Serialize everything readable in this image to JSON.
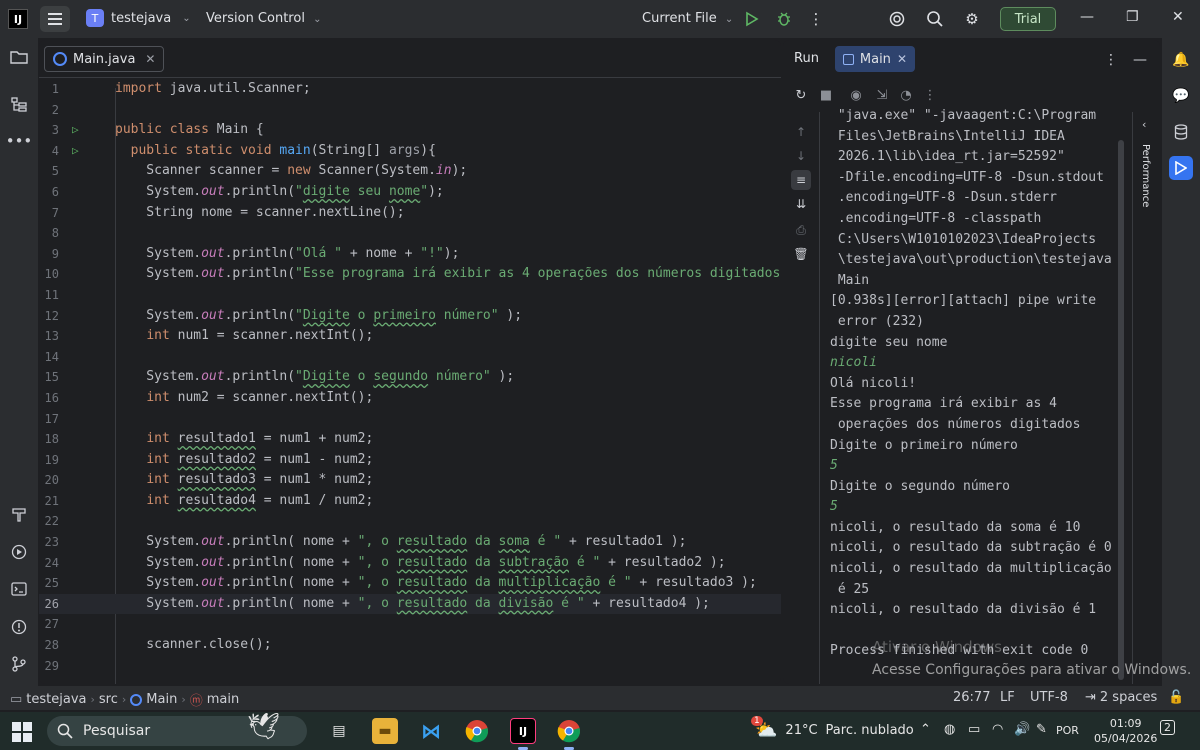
{
  "titlebar": {
    "app_logo": "IJ",
    "project_badge": "T",
    "project_name": "testejava",
    "vcs_label": "Version Control",
    "run_config": "Current File",
    "trial_label": "Trial",
    "icons": [
      "hamburger-menu-icon",
      "run-icon",
      "debug-icon",
      "more-icon",
      "ai-assistant-icon",
      "search-icon",
      "settings-gear-icon"
    ]
  },
  "editor": {
    "tab_label": "Main.java",
    "current_line": 26,
    "lines": [
      {
        "n": "1",
        "html": "<span class='kw'>import</span> java.util.Scanner;"
      },
      {
        "n": "2",
        "html": ""
      },
      {
        "n": "3",
        "html": "<span class='kw'>public class</span> Main {",
        "run": true
      },
      {
        "n": "4",
        "html": "  <span class='kw'>public static void</span> <span class='fn'>main</span>(String[] <span class='par'>args</span>){",
        "run": true
      },
      {
        "n": "5",
        "html": "    Scanner scanner = <span class='kw'>new</span> Scanner(System.<span class='fld'>in</span>);"
      },
      {
        "n": "6",
        "html": "    System.<span class='fld'>out</span>.println(<span class='str'>\"<span class='wavy'>digite</span> seu <span class='wavy'>nome</span>\"</span>);"
      },
      {
        "n": "7",
        "html": "    String nome = scanner.nextLine();"
      },
      {
        "n": "8",
        "html": ""
      },
      {
        "n": "9",
        "html": "    System.<span class='fld'>out</span>.println(<span class='str'>\"Olá \"</span> + nome + <span class='str'>\"!\"</span>);"
      },
      {
        "n": "10",
        "html": "    System.<span class='fld'>out</span>.println(<span class='str'>\"Esse programa irá exibir as 4 operações dos números digitados\"</span>);"
      },
      {
        "n": "11",
        "html": ""
      },
      {
        "n": "12",
        "html": "    System.<span class='fld'>out</span>.println(<span class='str'>\"<span class='wavy'>Digite</span> o <span class='wavy'>primeiro</span> número\"</span> );"
      },
      {
        "n": "13",
        "html": "    <span class='kw'>int</span> num1 = scanner.nextInt();"
      },
      {
        "n": "14",
        "html": ""
      },
      {
        "n": "15",
        "html": "    System.<span class='fld'>out</span>.println(<span class='str'>\"<span class='wavy'>Digite</span> o <span class='wavy'>segundo</span> número\"</span> );"
      },
      {
        "n": "16",
        "html": "    <span class='kw'>int</span> num2 = scanner.nextInt();"
      },
      {
        "n": "17",
        "html": ""
      },
      {
        "n": "18",
        "html": "    <span class='kw'>int</span> <span class='wavy2'>resultado1</span> = num1 + num2;"
      },
      {
        "n": "19",
        "html": "    <span class='kw'>int</span> <span class='wavy2'>resultado2</span> = num1 - num2;"
      },
      {
        "n": "20",
        "html": "    <span class='kw'>int</span> <span class='wavy2'>resultado3</span> = num1 * num2;"
      },
      {
        "n": "21",
        "html": "    <span class='kw'>int</span> <span class='wavy2'>resultado4</span> = num1 / num2;"
      },
      {
        "n": "22",
        "html": ""
      },
      {
        "n": "23",
        "html": "    System.<span class='fld'>out</span>.println( nome + <span class='str'>\", o <span class='wavy'>resultado</span> da <span class='wavy'>soma</span> é \"</span> + resultado1 );"
      },
      {
        "n": "24",
        "html": "    System.<span class='fld'>out</span>.println( nome + <span class='str'>\", o <span class='wavy'>resultado</span> da <span class='wavy'>subtração</span> é \"</span> + resultado2 );"
      },
      {
        "n": "25",
        "html": "    System.<span class='fld'>out</span>.println( nome + <span class='str'>\", o <span class='wavy'>resultado</span> da <span class='wavy'>multiplicação</span> é \"</span> + resultado3 );"
      },
      {
        "n": "26",
        "html": "    System.<span class='fld'>out</span>.println( nome + <span class='str'>\", o <span class='wavy'>resultado</span> da <span class='wavy'>divisão</span> é \"</span> + resultado4 );"
      },
      {
        "n": "27",
        "html": ""
      },
      {
        "n": "28",
        "html": "    scanner.close();"
      },
      {
        "n": "29",
        "html": ""
      }
    ]
  },
  "run": {
    "title": "Run",
    "tab_label": "Main",
    "performance_label": "Performance",
    "console": [
      {
        "t": " \"java.exe\" \"-javaagent:C:\\Program"
      },
      {
        "t": " Files\\JetBrains\\IntelliJ IDEA"
      },
      {
        "t": " 2026.1\\lib\\idea_rt.jar=52592\""
      },
      {
        "t": " -Dfile.encoding=UTF-8 -Dsun.stdout"
      },
      {
        "t": " .encoding=UTF-8 -Dsun.stderr"
      },
      {
        "t": " .encoding=UTF-8 -classpath"
      },
      {
        "t": " C:\\Users\\W1010102023\\IdeaProjects"
      },
      {
        "t": " \\testejava\\out\\production\\testejava"
      },
      {
        "t": " Main"
      },
      {
        "t": "[0.938s][error][attach] pipe write"
      },
      {
        "t": " error (232)"
      },
      {
        "t": "digite seu nome"
      },
      {
        "t": "nicoli",
        "input": true
      },
      {
        "t": "Olá nicoli!"
      },
      {
        "t": "Esse programa irá exibir as 4"
      },
      {
        "t": " operações dos números digitados"
      },
      {
        "t": "Digite o primeiro número"
      },
      {
        "t": "5",
        "input": true
      },
      {
        "t": "Digite o segundo número"
      },
      {
        "t": "5",
        "input": true
      },
      {
        "t": "nicoli, o resultado da soma é 10"
      },
      {
        "t": "nicoli, o resultado da subtração é 0"
      },
      {
        "t": "nicoli, o resultado da multiplicação"
      },
      {
        "t": " é 25"
      },
      {
        "t": "nicoli, o resultado da divisão é 1"
      },
      {
        "t": ""
      },
      {
        "t": "Process finished with exit code 0"
      }
    ]
  },
  "watermark": {
    "line1": "Ativar o Windows",
    "line2": "Acesse Configurações para ativar o Windows."
  },
  "statusbar": {
    "project": "testejava",
    "src": "src",
    "class": "Main",
    "method": "main",
    "position": "26:77",
    "line_sep": "LF",
    "encoding": "UTF-8",
    "indent": "2 spaces"
  },
  "taskbar": {
    "search_placeholder": "Pesquisar",
    "temperature": "21°C",
    "weather": "Parc. nublado",
    "weather_badge": "1",
    "language": "POR",
    "time": "01:09",
    "date": "05/04/2026",
    "notifications": "2"
  },
  "colors": {
    "accent": "#3574f0",
    "keyword": "#cf8e6d",
    "string": "#6aab73",
    "function": "#56a8f5",
    "field": "#c77dbb"
  }
}
